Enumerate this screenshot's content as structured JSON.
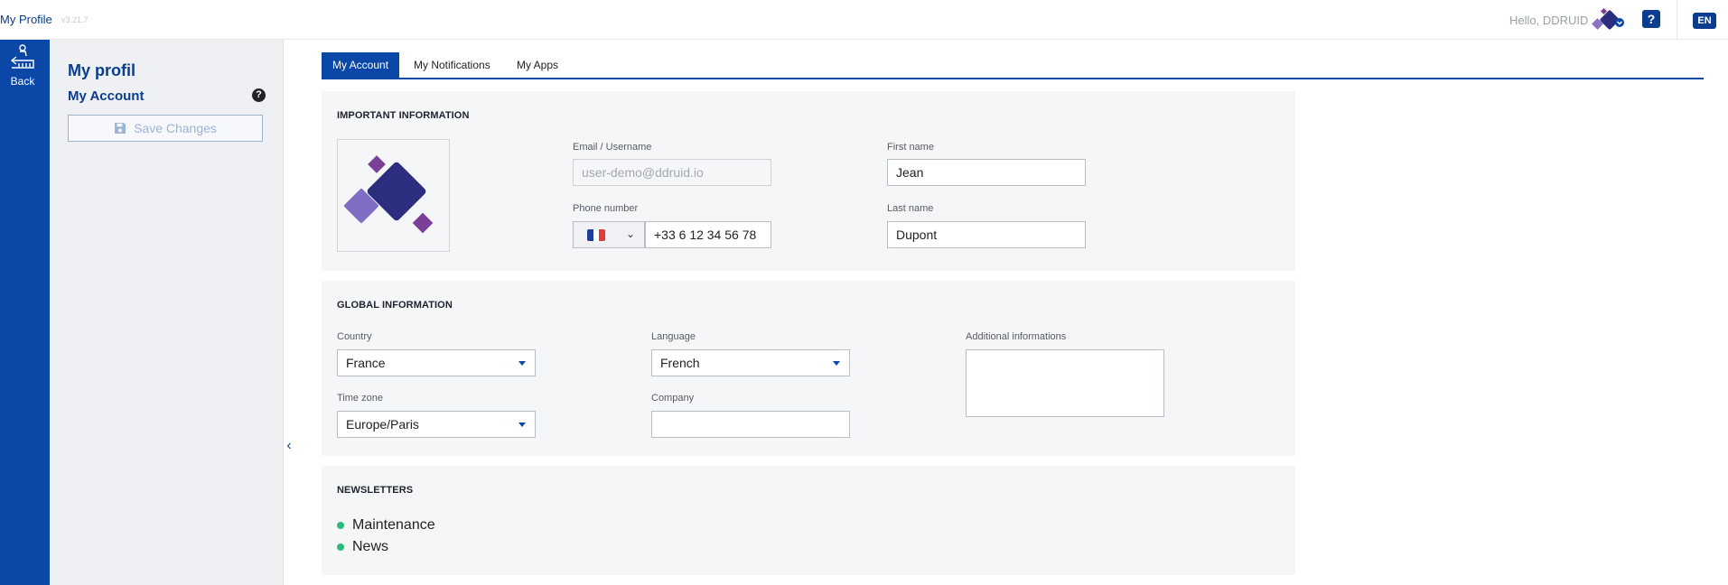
{
  "topbar": {
    "app_title": "My Profile",
    "version": "v3.21.7",
    "greeting": "Hello, DDRUID",
    "help_icon": "question-icon",
    "language": "EN"
  },
  "rail": {
    "back_label": "Back",
    "back_icon": "back-arrow-icon"
  },
  "sidepanel": {
    "title": "My profil",
    "subtitle": "My Account",
    "help_glyph": "?",
    "save_label": "Save Changes",
    "collapse_glyph": "‹"
  },
  "tabs": [
    {
      "label": "My Account",
      "active": true
    },
    {
      "label": "My Notifications",
      "active": false
    },
    {
      "label": "My Apps",
      "active": false
    }
  ],
  "important": {
    "title": "IMPORTANT INFORMATION",
    "email_label": "Email / Username",
    "email_value": "user-demo@ddruid.io",
    "phone_label": "Phone number",
    "phone_value": "+33 6 12 34 56 78",
    "first_name_label": "First name",
    "first_name_value": "Jean",
    "last_name_label": "Last name",
    "last_name_value": "Dupont"
  },
  "global": {
    "title": "GLOBAL INFORMATION",
    "country_label": "Country",
    "country_value": "France",
    "language_label": "Language",
    "language_value": "French",
    "additional_label": "Additional informations",
    "additional_value": "",
    "timezone_label": "Time zone",
    "timezone_value": "Europe/Paris",
    "company_label": "Company",
    "company_value": ""
  },
  "newsletters": {
    "title": "NEWSLETTERS",
    "items": [
      "Maintenance",
      "News"
    ]
  },
  "colors": {
    "brand": "#0a47a6",
    "accent_purple": "#7b3f98",
    "bullet_green": "#2eba7a"
  }
}
